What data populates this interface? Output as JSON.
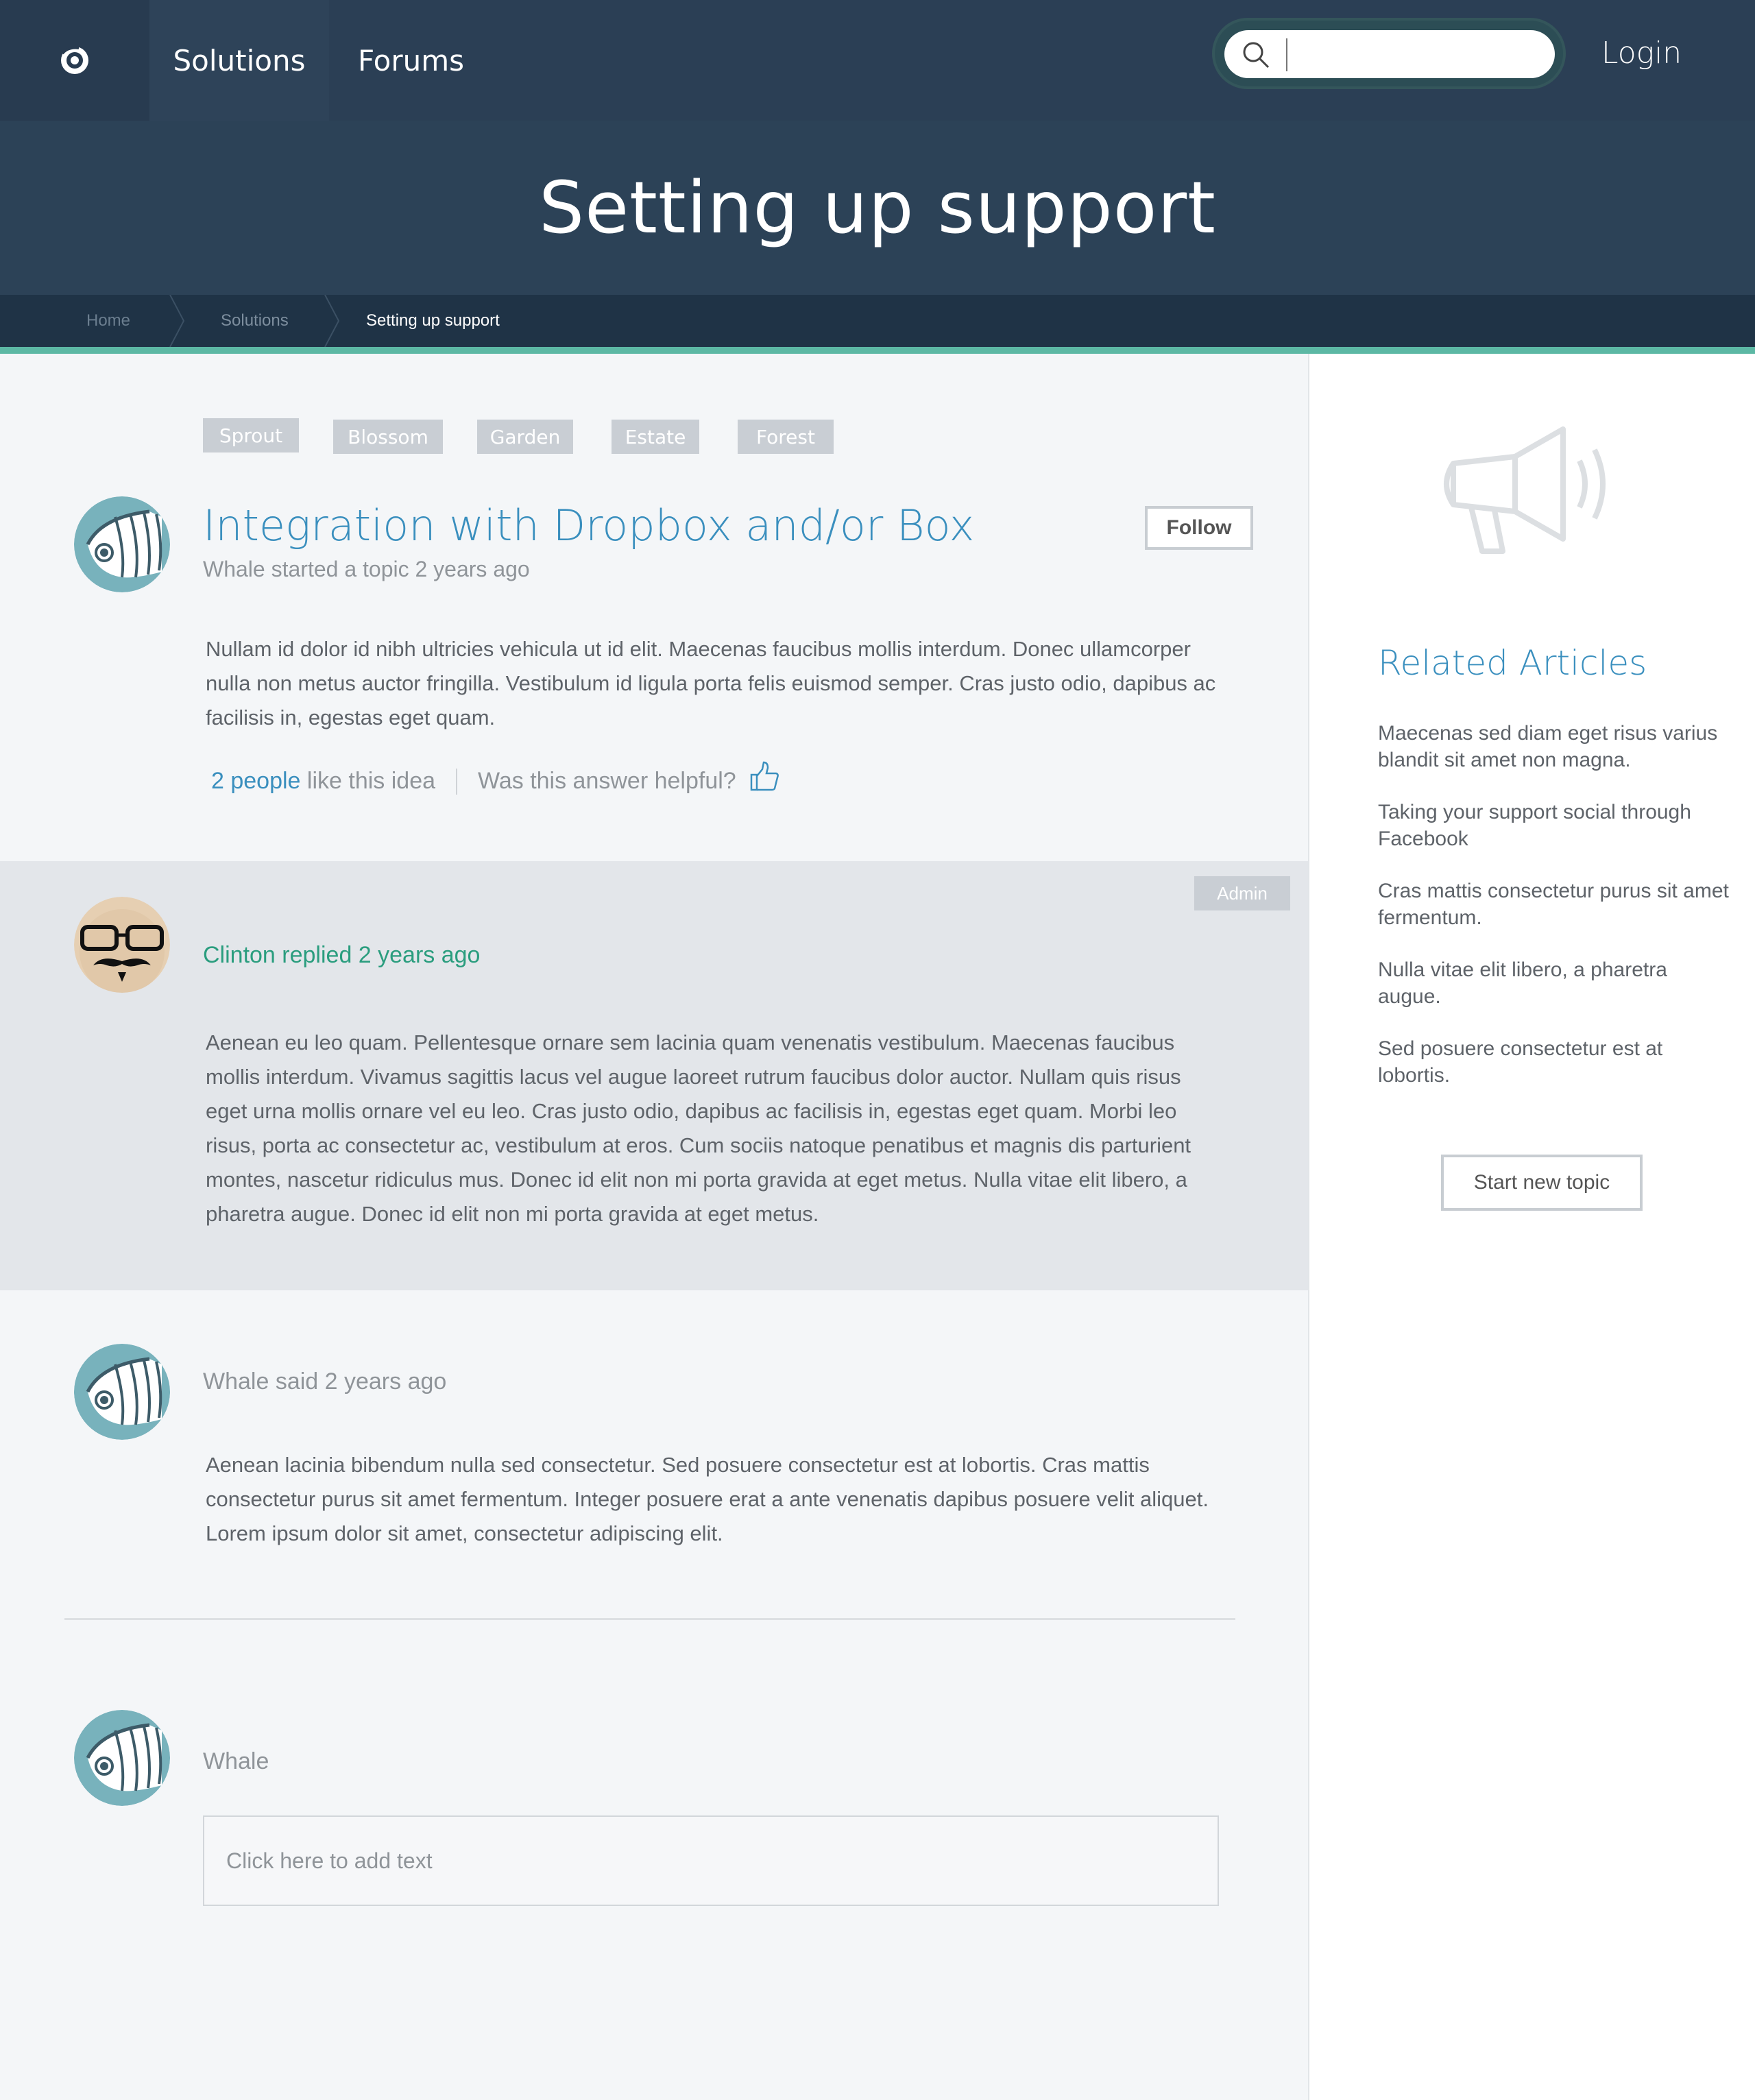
{
  "nav": {
    "items": [
      "Solutions",
      "Forums"
    ],
    "login": "Login",
    "search_placeholder": ""
  },
  "hero": {
    "title": "Setting up support"
  },
  "breadcrumb": [
    "Home",
    "Solutions",
    "Setting up support"
  ],
  "tags": [
    "Sprout",
    "Blossom",
    "Garden",
    "Estate",
    "Forest"
  ],
  "topic": {
    "title": "Integration with Dropbox and/or Box",
    "meta": "Whale started a topic 2 years ago",
    "follow": "Follow",
    "body": "Nullam id dolor id nibh ultricies vehicula ut id elit. Maecenas faucibus mollis interdum. Donec ullamcorper nulla non metus auctor fringilla. Vestibulum id ligula porta felis euismod semper. Cras justo odio, dapibus ac facilisis in, egestas eget quam.",
    "likes_count": "2 people",
    "likes_text": " like this idea",
    "helpful": "Was this answer helpful?"
  },
  "reply": {
    "badge": "Admin",
    "meta": "Clinton replied 2 years ago",
    "body": "Aenean eu leo quam. Pellentesque ornare sem lacinia quam venenatis vestibulum. Maecenas faucibus mollis interdum. Vivamus sagittis lacus vel augue laoreet rutrum faucibus dolor auctor. Nullam quis risus eget urna mollis ornare vel eu leo. Cras justo odio, dapibus ac facilisis in, egestas eget quam. Morbi leo risus, porta ac consectetur ac, vestibulum at eros. Cum sociis natoque penatibus et magnis dis parturient montes, nascetur ridiculus mus. Donec id elit non mi porta gravida at eget metus. Nulla vitae elit libero, a pharetra augue. Donec id elit non mi porta gravida at eget metus."
  },
  "comment": {
    "meta": "Whale said 2 years ago",
    "body": "Aenean lacinia bibendum nulla sed consectetur. Sed posuere consectetur est at lobortis. Cras mattis consectetur purus sit amet fermentum. Integer posuere erat a ante venenatis dapibus posuere velit aliquet. Lorem ipsum dolor sit amet, consectetur adipiscing elit."
  },
  "compose": {
    "name": "Whale",
    "placeholder": "Click here to add text"
  },
  "sidebar": {
    "title": "Related Articles",
    "articles": [
      "Maecenas sed diam eget risus varius blandit sit amet non magna.",
      "Taking your support social through Facebook",
      "Cras mattis consectetur purus sit amet fermentum.",
      "Nulla vitae elit libero, a pharetra augue.",
      "Sed posuere consectetur est at lobortis."
    ],
    "button": "Start new topic"
  },
  "colors": {
    "nav_bg": "#2b3f55",
    "accent": "#5cb8a4",
    "link": "#3a8fbe",
    "reply_name": "#2a9d7e"
  },
  "icons": [
    "logo-icon",
    "search-icon",
    "thumbs-up-icon",
    "megaphone-icon"
  ]
}
